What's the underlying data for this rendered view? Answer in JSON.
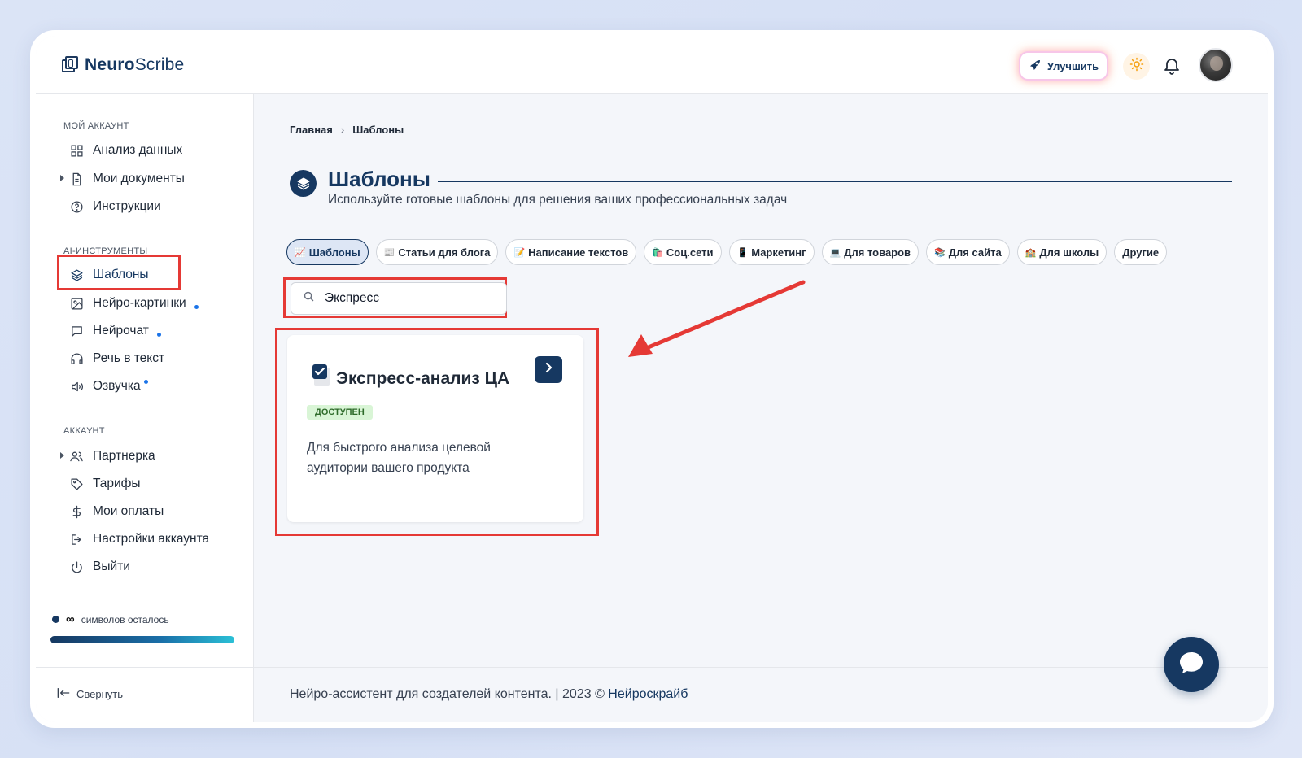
{
  "app": {
    "logo_bold": "Neuro",
    "logo_rest": "Scribe",
    "upgrade_label": "Улучшить"
  },
  "sidebar": {
    "sections": [
      {
        "title": "Мой аккаунт"
      },
      {
        "title": "AI-инструменты"
      },
      {
        "title": "Аккаунт"
      }
    ],
    "items": [
      {
        "label": "Анализ данных",
        "icon": "grid-icon"
      },
      {
        "label": "Мои документы",
        "icon": "document-icon"
      },
      {
        "label": "Инструкции",
        "icon": "help-circle-icon"
      },
      {
        "label": "Шаблоны",
        "icon": "layers-icon"
      },
      {
        "label": "Нейро-картинки",
        "icon": "image-icon"
      },
      {
        "label": "Нейрочат",
        "icon": "chat-bubble-icon"
      },
      {
        "label": "Речь в текст",
        "icon": "headphones-icon"
      },
      {
        "label": "Озвучка",
        "icon": "speaker-icon"
      },
      {
        "label": "Партнерка",
        "icon": "users-icon"
      },
      {
        "label": "Тарифы",
        "icon": "tag-icon"
      },
      {
        "label": "Мои оплаты",
        "icon": "dollar-icon"
      },
      {
        "label": "Настройки аккаунта",
        "icon": "login-icon"
      },
      {
        "label": "Выйти",
        "icon": "power-icon"
      }
    ],
    "credits_symbol": "∞",
    "credits_label": "символов осталось",
    "credits_fill": 1.0,
    "collapse_label": "Свернуть"
  },
  "breadcrumb": {
    "home": "Главная",
    "separator": "›",
    "current": "Шаблоны"
  },
  "page": {
    "title": "Шаблоны",
    "subtitle": "Используйте готовые шаблоны для решения ваших профессиональных задач"
  },
  "filters": [
    {
      "emoji": "📈",
      "label": "Шаблоны",
      "active": true
    },
    {
      "emoji": "📰",
      "label": "Статьи для блога"
    },
    {
      "emoji": "📝",
      "label": "Написание текстов"
    },
    {
      "emoji": "🛍️",
      "label": "Соц.сети"
    },
    {
      "emoji": "📱",
      "label": "Маркетинг"
    },
    {
      "emoji": "💻",
      "label": "Для товаров"
    },
    {
      "emoji": "📚",
      "label": "Для сайта"
    },
    {
      "emoji": "🏫",
      "label": "Для школы"
    },
    {
      "emoji": "",
      "label": "Другие"
    }
  ],
  "search": {
    "value": "Экспресс",
    "icon": "search-icon"
  },
  "card": {
    "title": "Экспресс-анализ ЦА",
    "badge": "Доступен",
    "description": "Для быстрого анализа целевой аудитории вашего продукта"
  },
  "footer": {
    "text": "Нейро-ассистент для создателей контента.  | 2023 © ",
    "link": "Нейроскрайб"
  },
  "colors": {
    "brand": "#163861",
    "highlight": "#e53935",
    "badge_bg": "#d9f5d6"
  }
}
